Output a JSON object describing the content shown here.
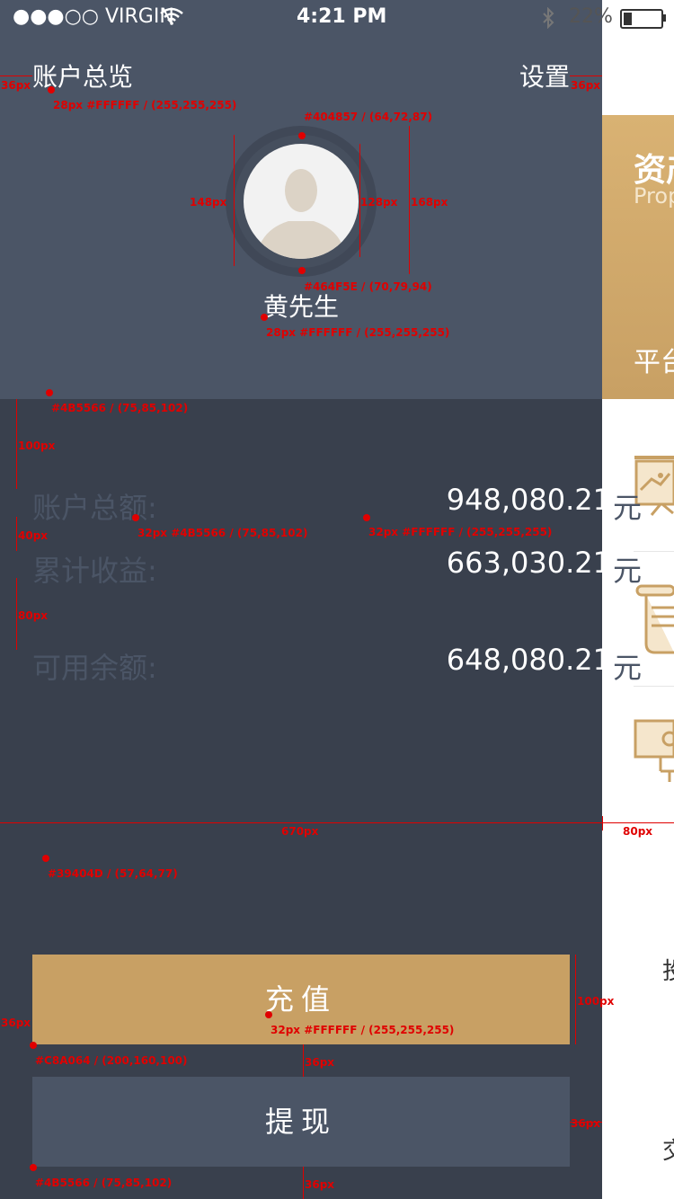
{
  "status_bar": {
    "carrier": "●●●○○ VIRGIN",
    "time": "4:21 PM",
    "battery": "22%",
    "battery_level": 0.22
  },
  "drawer": {
    "title": "账户总览",
    "settings": "设置",
    "username": "黄先生",
    "stats": [
      {
        "label": "账户总额:",
        "value": "948,080.21",
        "unit": "元"
      },
      {
        "label": "累计收益:",
        "value": "663,030.21",
        "unit": "元"
      },
      {
        "label": "可用余额:",
        "value": "648,080.21",
        "unit": "元"
      }
    ],
    "recharge_label": "充值",
    "withdraw_label": "提现"
  },
  "peek": {
    "card_title": "资产",
    "card_subtitle": "Prop",
    "card_bottom": "平台",
    "item_a": "投",
    "item_b": "交"
  },
  "annotations": {
    "a1": "36px",
    "a2": "28px #FFFFFF / (255,255,255)",
    "a3": "36px",
    "a4": "#404857 / (64,72,87)",
    "a5": "148px",
    "a6": "128px",
    "a7": "168px",
    "a8": "#464F5E / (70,79,94)",
    "a9": "28px #FFFFFF / (255,255,255)",
    "a10": "#4B5566 / (75,85,102)",
    "a11": "100px",
    "a12": "40px",
    "a13": "32px #4B5566 / (75,85,102)",
    "a14": "32px #FFFFFF / (255,255,255)",
    "a15": "80px",
    "a16": "670px",
    "a17": "80px",
    "a18": "#39404D / (57,64,77)",
    "a19": "100px",
    "a20": "36px",
    "a21": "32px #FFFFFF / (255,255,255)",
    "a22": "#C8A064 / (200,160,100)",
    "a23": "36px",
    "a24": "36px",
    "a25": "#4B5566 / (75,85,102)",
    "a26": "36px"
  },
  "colors": {
    "top_bg": "#4B5566",
    "panel_bg": "#39404D",
    "gold": "#C8A064",
    "ring": "#404857",
    "ring_inner": "#464F5E"
  }
}
